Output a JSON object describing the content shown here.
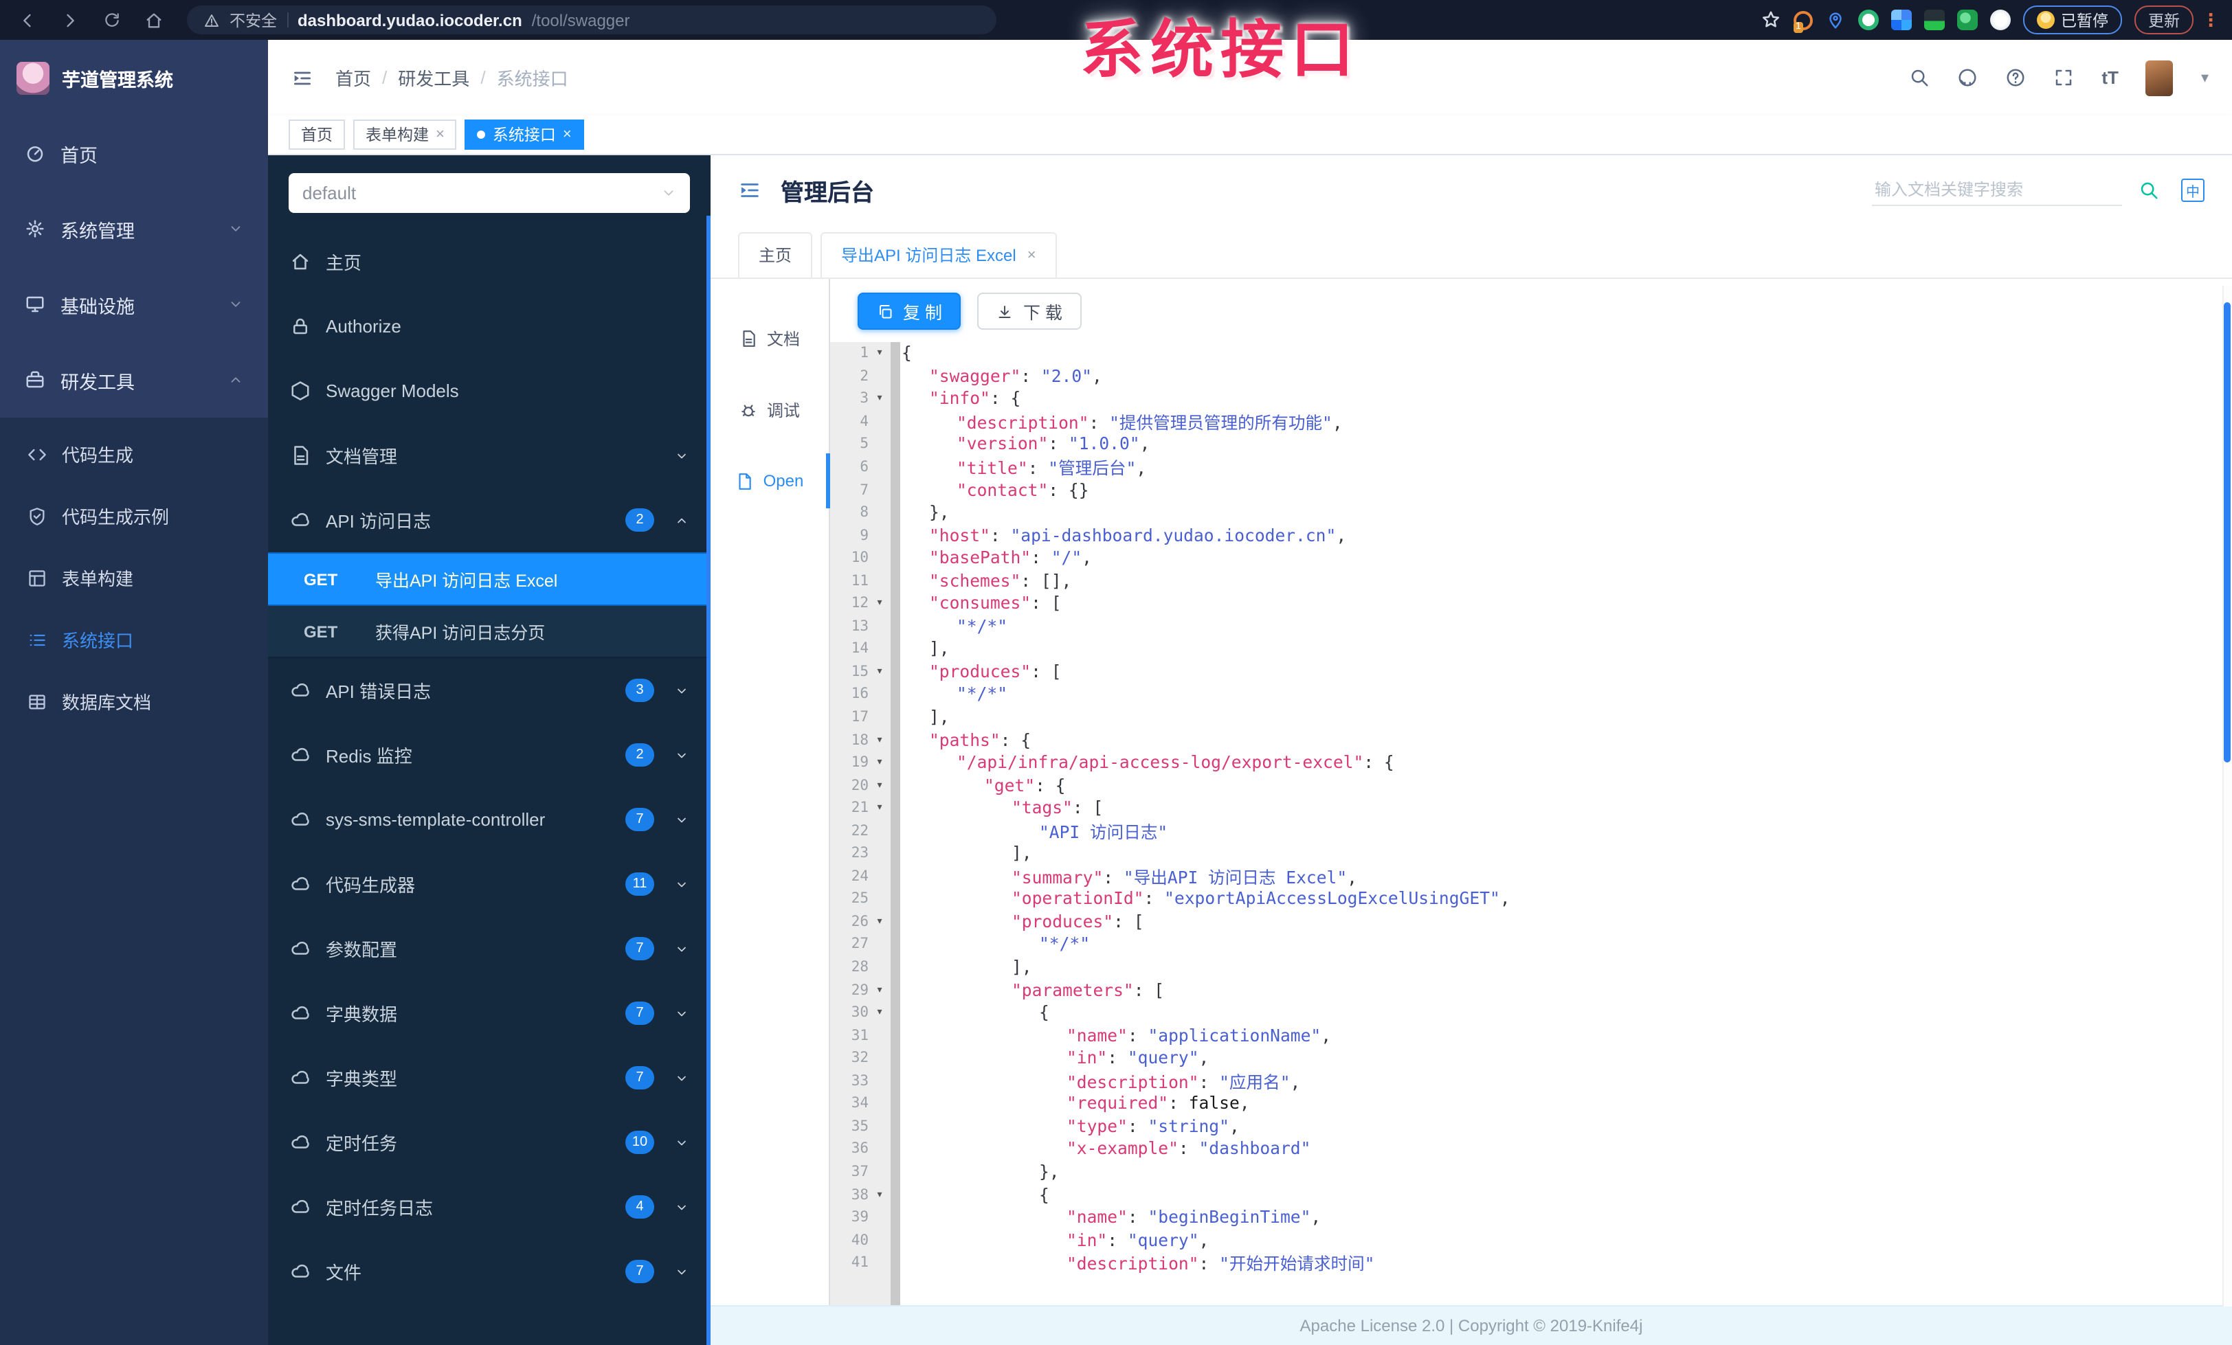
{
  "overlay_text": "系统接口",
  "browser": {
    "security_label": "不安全",
    "url_host": "dashboard.yudao.iocoder.cn",
    "url_path": "/tool/swagger",
    "ext_badge": "1",
    "paused_label": "已暂停",
    "update_label": "更新",
    "menu_dots": "⋮"
  },
  "app": {
    "logo_text": "芋道管理系统",
    "breadcrumb": [
      "首页",
      "研发工具",
      "系统接口"
    ],
    "tag_tabs": [
      {
        "label": "首页",
        "closable": false,
        "active": false
      },
      {
        "label": "表单构建",
        "closable": true,
        "active": false
      },
      {
        "label": "系统接口",
        "closable": true,
        "active": true
      }
    ],
    "menu": [
      {
        "label": "首页",
        "icon": "dashboard"
      },
      {
        "label": "系统管理",
        "icon": "gear",
        "chevron": "down"
      },
      {
        "label": "基础设施",
        "icon": "monitor",
        "chevron": "down"
      },
      {
        "label": "研发工具",
        "icon": "toolbox",
        "chevron": "up"
      }
    ],
    "submenu": [
      {
        "label": "代码生成",
        "icon": "code",
        "active": false
      },
      {
        "label": "代码生成示例",
        "icon": "shield",
        "active": false
      },
      {
        "label": "表单构建",
        "icon": "form",
        "active": false
      },
      {
        "label": "系统接口",
        "icon": "list",
        "active": true
      },
      {
        "label": "数据库文档",
        "icon": "table",
        "active": false
      }
    ]
  },
  "swagger": {
    "group_select": "default",
    "nav": [
      {
        "label": "主页",
        "icon": "home"
      },
      {
        "label": "Authorize",
        "icon": "lock"
      },
      {
        "label": "Swagger Models",
        "icon": "hexagon"
      },
      {
        "label": "文档管理",
        "icon": "doc",
        "chevron": "down"
      },
      {
        "label": "API 访问日志",
        "icon": "cloud",
        "badge": "2",
        "chevron": "up",
        "children": [
          {
            "method": "GET",
            "label": "导出API 访问日志 Excel",
            "active": true
          },
          {
            "method": "GET",
            "label": "获得API 访问日志分页",
            "active": false
          }
        ]
      },
      {
        "label": "API 错误日志",
        "icon": "cloud",
        "badge": "3",
        "chevron": "down"
      },
      {
        "label": "Redis 监控",
        "icon": "cloud",
        "badge": "2",
        "chevron": "down"
      },
      {
        "label": "sys-sms-template-controller",
        "icon": "cloud",
        "badge": "7",
        "chevron": "down"
      },
      {
        "label": "代码生成器",
        "icon": "cloud",
        "badge": "11",
        "chevron": "down"
      },
      {
        "label": "参数配置",
        "icon": "cloud",
        "badge": "7",
        "chevron": "down"
      },
      {
        "label": "字典数据",
        "icon": "cloud",
        "badge": "7",
        "chevron": "down"
      },
      {
        "label": "字典类型",
        "icon": "cloud",
        "badge": "7",
        "chevron": "down"
      },
      {
        "label": "定时任务",
        "icon": "cloud",
        "badge": "10",
        "chevron": "down"
      },
      {
        "label": "定时任务日志",
        "icon": "cloud",
        "badge": "4",
        "chevron": "down"
      },
      {
        "label": "文件",
        "icon": "cloud",
        "badge": "7",
        "chevron": "down",
        "partial": true
      }
    ]
  },
  "doc": {
    "title": "管理后台",
    "search_placeholder": "输入文档关键字搜索",
    "lang_label": "中",
    "tabs": [
      {
        "label": "主页",
        "active": false,
        "closable": false
      },
      {
        "label": "导出API 访问日志 Excel",
        "active": true,
        "closable": true
      }
    ],
    "side_tabs": [
      {
        "label": "文档",
        "icon": "doc",
        "active": false
      },
      {
        "label": "调试",
        "icon": "bug",
        "active": false
      },
      {
        "label": "Open",
        "icon": "file",
        "active": true
      }
    ],
    "copy_label": "复 制",
    "download_label": "下 载",
    "footer": "Apache License 2.0 | Copyright © 2019-Knife4j"
  },
  "code": {
    "lines": [
      {
        "n": 1,
        "i": 0,
        "f": true,
        "t": [
          [
            "p",
            "{"
          ]
        ]
      },
      {
        "n": 2,
        "i": 1,
        "t": [
          [
            "k",
            "\"swagger\""
          ],
          [
            "p",
            ": "
          ],
          [
            "s",
            "\"2.0\""
          ],
          [
            "p",
            ","
          ]
        ]
      },
      {
        "n": 3,
        "i": 1,
        "f": true,
        "t": [
          [
            "k",
            "\"info\""
          ],
          [
            "p",
            ": {"
          ]
        ]
      },
      {
        "n": 4,
        "i": 2,
        "t": [
          [
            "k",
            "\"description\""
          ],
          [
            "p",
            ": "
          ],
          [
            "s",
            "\"提供管理员管理的所有功能\""
          ],
          [
            "p",
            ","
          ]
        ]
      },
      {
        "n": 5,
        "i": 2,
        "t": [
          [
            "k",
            "\"version\""
          ],
          [
            "p",
            ": "
          ],
          [
            "s",
            "\"1.0.0\""
          ],
          [
            "p",
            ","
          ]
        ]
      },
      {
        "n": 6,
        "i": 2,
        "t": [
          [
            "k",
            "\"title\""
          ],
          [
            "p",
            ": "
          ],
          [
            "s",
            "\"管理后台\""
          ],
          [
            "p",
            ","
          ]
        ]
      },
      {
        "n": 7,
        "i": 2,
        "t": [
          [
            "k",
            "\"contact\""
          ],
          [
            "p",
            ": {}"
          ]
        ]
      },
      {
        "n": 8,
        "i": 1,
        "t": [
          [
            "p",
            "},"
          ]
        ]
      },
      {
        "n": 9,
        "i": 1,
        "t": [
          [
            "k",
            "\"host\""
          ],
          [
            "p",
            ": "
          ],
          [
            "s",
            "\"api-dashboard.yudao.iocoder.cn\""
          ],
          [
            "p",
            ","
          ]
        ]
      },
      {
        "n": 10,
        "i": 1,
        "t": [
          [
            "k",
            "\"basePath\""
          ],
          [
            "p",
            ": "
          ],
          [
            "s",
            "\"/\""
          ],
          [
            "p",
            ","
          ]
        ]
      },
      {
        "n": 11,
        "i": 1,
        "t": [
          [
            "k",
            "\"schemes\""
          ],
          [
            "p",
            ": [],"
          ]
        ]
      },
      {
        "n": 12,
        "i": 1,
        "f": true,
        "t": [
          [
            "k",
            "\"consumes\""
          ],
          [
            "p",
            ": ["
          ]
        ]
      },
      {
        "n": 13,
        "i": 2,
        "t": [
          [
            "s",
            "\"*/*\""
          ]
        ]
      },
      {
        "n": 14,
        "i": 1,
        "t": [
          [
            "p",
            "],"
          ]
        ]
      },
      {
        "n": 15,
        "i": 1,
        "f": true,
        "t": [
          [
            "k",
            "\"produces\""
          ],
          [
            "p",
            ": ["
          ]
        ]
      },
      {
        "n": 16,
        "i": 2,
        "t": [
          [
            "s",
            "\"*/*\""
          ]
        ]
      },
      {
        "n": 17,
        "i": 1,
        "t": [
          [
            "p",
            "],"
          ]
        ]
      },
      {
        "n": 18,
        "i": 1,
        "f": true,
        "t": [
          [
            "k",
            "\"paths\""
          ],
          [
            "p",
            ": {"
          ]
        ]
      },
      {
        "n": 19,
        "i": 2,
        "f": true,
        "t": [
          [
            "k",
            "\"/api/infra/api-access-log/export-excel\""
          ],
          [
            "p",
            ": {"
          ]
        ]
      },
      {
        "n": 20,
        "i": 3,
        "f": true,
        "t": [
          [
            "k",
            "\"get\""
          ],
          [
            "p",
            ": {"
          ]
        ]
      },
      {
        "n": 21,
        "i": 4,
        "f": true,
        "t": [
          [
            "k",
            "\"tags\""
          ],
          [
            "p",
            ": ["
          ]
        ]
      },
      {
        "n": 22,
        "i": 5,
        "t": [
          [
            "s",
            "\"API 访问日志\""
          ]
        ]
      },
      {
        "n": 23,
        "i": 4,
        "t": [
          [
            "p",
            "],"
          ]
        ]
      },
      {
        "n": 24,
        "i": 4,
        "t": [
          [
            "k",
            "\"summary\""
          ],
          [
            "p",
            ": "
          ],
          [
            "s",
            "\"导出API 访问日志 Excel\""
          ],
          [
            "p",
            ","
          ]
        ]
      },
      {
        "n": 25,
        "i": 4,
        "t": [
          [
            "k",
            "\"operationId\""
          ],
          [
            "p",
            ": "
          ],
          [
            "s",
            "\"exportApiAccessLogExcelUsingGET\""
          ],
          [
            "p",
            ","
          ]
        ]
      },
      {
        "n": 26,
        "i": 4,
        "f": true,
        "t": [
          [
            "k",
            "\"produces\""
          ],
          [
            "p",
            ": ["
          ]
        ]
      },
      {
        "n": 27,
        "i": 5,
        "t": [
          [
            "s",
            "\"*/*\""
          ]
        ]
      },
      {
        "n": 28,
        "i": 4,
        "t": [
          [
            "p",
            "],"
          ]
        ]
      },
      {
        "n": 29,
        "i": 4,
        "f": true,
        "t": [
          [
            "k",
            "\"parameters\""
          ],
          [
            "p",
            ": ["
          ]
        ]
      },
      {
        "n": 30,
        "i": 5,
        "f": true,
        "t": [
          [
            "p",
            "{"
          ]
        ]
      },
      {
        "n": 31,
        "i": 6,
        "t": [
          [
            "k",
            "\"name\""
          ],
          [
            "p",
            ": "
          ],
          [
            "s",
            "\"applicationName\""
          ],
          [
            "p",
            ","
          ]
        ]
      },
      {
        "n": 32,
        "i": 6,
        "t": [
          [
            "k",
            "\"in\""
          ],
          [
            "p",
            ": "
          ],
          [
            "s",
            "\"query\""
          ],
          [
            "p",
            ","
          ]
        ]
      },
      {
        "n": 33,
        "i": 6,
        "t": [
          [
            "k",
            "\"description\""
          ],
          [
            "p",
            ": "
          ],
          [
            "s",
            "\"应用名\""
          ],
          [
            "p",
            ","
          ]
        ]
      },
      {
        "n": 34,
        "i": 6,
        "t": [
          [
            "k",
            "\"required\""
          ],
          [
            "p",
            ": "
          ],
          [
            "b",
            "false"
          ],
          [
            "p",
            ","
          ]
        ]
      },
      {
        "n": 35,
        "i": 6,
        "t": [
          [
            "k",
            "\"type\""
          ],
          [
            "p",
            ": "
          ],
          [
            "s",
            "\"string\""
          ],
          [
            "p",
            ","
          ]
        ]
      },
      {
        "n": 36,
        "i": 6,
        "t": [
          [
            "k",
            "\"x-example\""
          ],
          [
            "p",
            ": "
          ],
          [
            "s",
            "\"dashboard\""
          ]
        ]
      },
      {
        "n": 37,
        "i": 5,
        "t": [
          [
            "p",
            "},"
          ]
        ]
      },
      {
        "n": 38,
        "i": 5,
        "f": true,
        "t": [
          [
            "p",
            "{"
          ]
        ]
      },
      {
        "n": 39,
        "i": 6,
        "t": [
          [
            "k",
            "\"name\""
          ],
          [
            "p",
            ": "
          ],
          [
            "s",
            "\"beginBeginTime\""
          ],
          [
            "p",
            ","
          ]
        ]
      },
      {
        "n": 40,
        "i": 6,
        "t": [
          [
            "k",
            "\"in\""
          ],
          [
            "p",
            ": "
          ],
          [
            "s",
            "\"query\""
          ],
          [
            "p",
            ","
          ]
        ]
      },
      {
        "n": 41,
        "i": 6,
        "t": [
          [
            "k",
            "\"description\""
          ],
          [
            "p",
            ": "
          ],
          [
            "s",
            "\"开始开始请求时间\""
          ]
        ]
      }
    ]
  }
}
